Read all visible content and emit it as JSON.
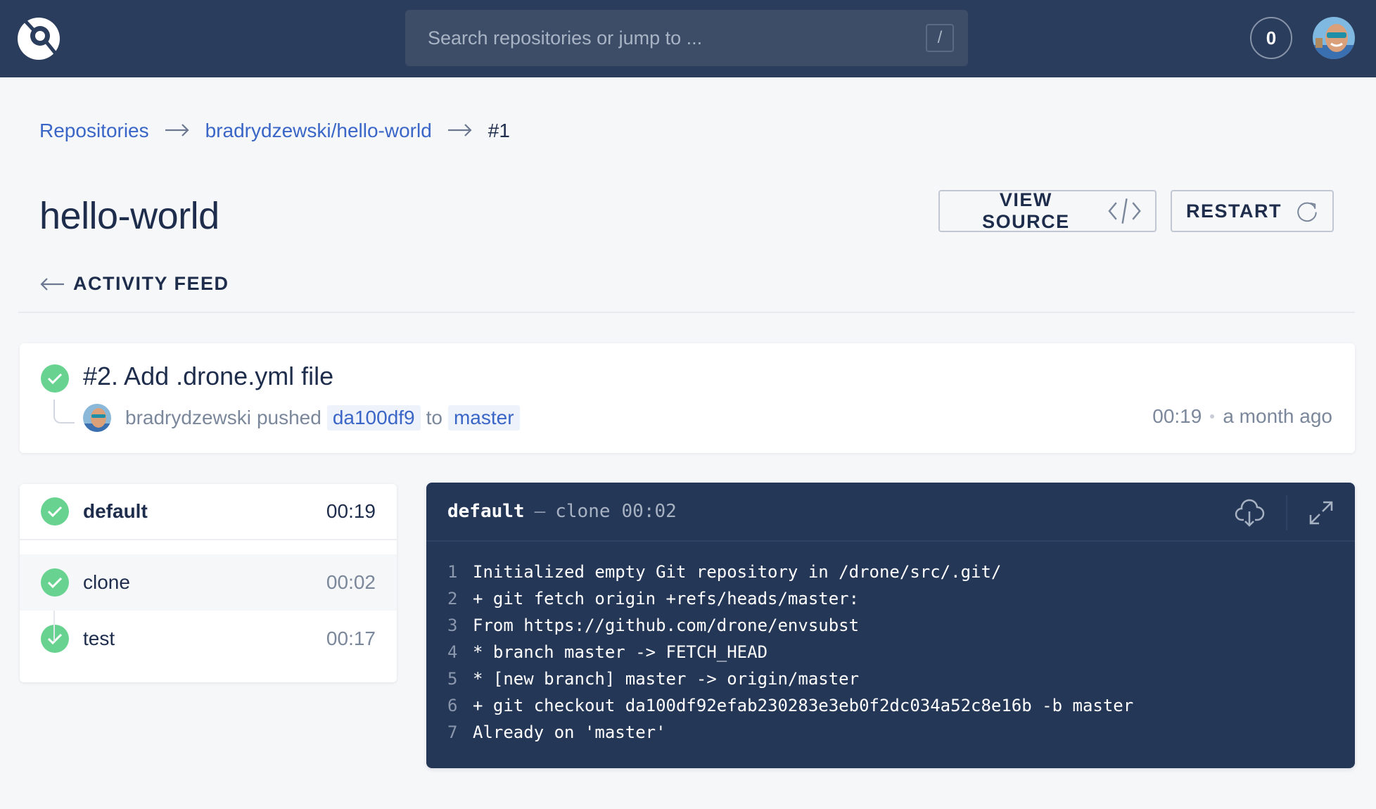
{
  "header": {
    "search_placeholder": "Search repositories or jump to ...",
    "search_shortcut": "/",
    "notification_count": "0"
  },
  "breadcrumb": {
    "items": [
      {
        "label": "Repositories"
      },
      {
        "label": "bradrydzewski/hello-world"
      },
      {
        "label": "#1"
      }
    ]
  },
  "page": {
    "title": "hello-world",
    "view_source_label": "VIEW SOURCE",
    "restart_label": "RESTART",
    "back_label": "ACTIVITY FEED"
  },
  "build": {
    "title": "#2. Add .drone.yml file",
    "author": "bradrydzewski",
    "action": "pushed",
    "commit": "da100df9",
    "to_label": "to",
    "branch": "master",
    "duration": "00:19",
    "when": "a month ago",
    "status": "success"
  },
  "stages": {
    "stage": {
      "name": "default",
      "time": "00:19",
      "status": "success"
    },
    "steps": [
      {
        "name": "clone",
        "time": "00:02",
        "status": "success"
      },
      {
        "name": "test",
        "time": "00:17",
        "status": "success"
      }
    ]
  },
  "log": {
    "stage": "default",
    "separator": "–",
    "step": "clone",
    "time": "00:02",
    "lines": [
      {
        "n": "1",
        "text": "Initialized empty Git repository in /drone/src/.git/"
      },
      {
        "n": "2",
        "text": "+ git fetch origin +refs/heads/master:"
      },
      {
        "n": "3",
        "text": "From https://github.com/drone/envsubst"
      },
      {
        "n": "4",
        "text": "* branch master -> FETCH_HEAD"
      },
      {
        "n": "5",
        "text": "* [new branch] master -> origin/master"
      },
      {
        "n": "6",
        "text": "+ git checkout da100df92efab230283e3eb0f2dc034a52c8e16b -b master"
      },
      {
        "n": "7",
        "text": "Already on 'master'"
      }
    ]
  },
  "colors": {
    "header_bg": "#2b3d5c",
    "link": "#3a66c7",
    "success": "#68d391",
    "log_bg": "#253757"
  }
}
